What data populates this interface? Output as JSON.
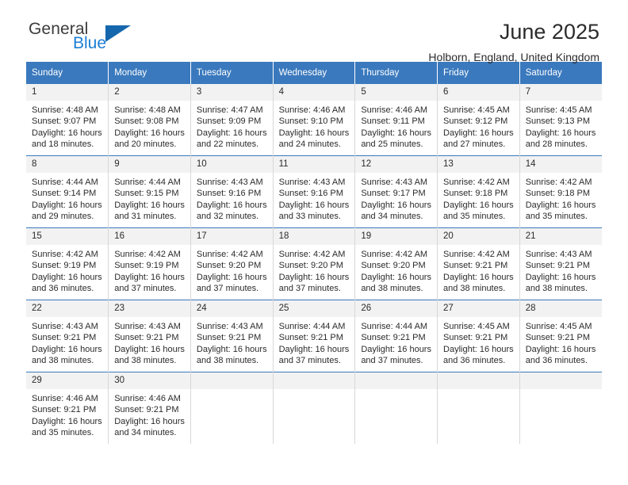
{
  "logo": {
    "primary_text": "General",
    "secondary_text": "Blue",
    "primary_color": "#3c3c3c",
    "secondary_color": "#1c7fd4",
    "triangle_color": "#1567ad"
  },
  "header": {
    "title": "June 2025",
    "subtitle": "Holborn, England, United Kingdom"
  },
  "theme": {
    "header_row_bg": "#3a79bd",
    "header_row_text": "#ffffff",
    "daynum_bg": "#f2f2f2",
    "row_divider": "#3a79bd",
    "cell_divider": "#d7d7d7"
  },
  "calendar": {
    "weekday_headers": [
      "Sunday",
      "Monday",
      "Tuesday",
      "Wednesday",
      "Thursday",
      "Friday",
      "Saturday"
    ],
    "labels": {
      "sunrise": "Sunrise:",
      "sunset": "Sunset:",
      "daylight": "Daylight:"
    },
    "weeks": [
      [
        {
          "day": "1",
          "sunrise": "Sunrise: 4:48 AM",
          "sunset": "Sunset: 9:07 PM",
          "daylight_line1": "Daylight: 16 hours",
          "daylight_line2": "and 18 minutes."
        },
        {
          "day": "2",
          "sunrise": "Sunrise: 4:48 AM",
          "sunset": "Sunset: 9:08 PM",
          "daylight_line1": "Daylight: 16 hours",
          "daylight_line2": "and 20 minutes."
        },
        {
          "day": "3",
          "sunrise": "Sunrise: 4:47 AM",
          "sunset": "Sunset: 9:09 PM",
          "daylight_line1": "Daylight: 16 hours",
          "daylight_line2": "and 22 minutes."
        },
        {
          "day": "4",
          "sunrise": "Sunrise: 4:46 AM",
          "sunset": "Sunset: 9:10 PM",
          "daylight_line1": "Daylight: 16 hours",
          "daylight_line2": "and 24 minutes."
        },
        {
          "day": "5",
          "sunrise": "Sunrise: 4:46 AM",
          "sunset": "Sunset: 9:11 PM",
          "daylight_line1": "Daylight: 16 hours",
          "daylight_line2": "and 25 minutes."
        },
        {
          "day": "6",
          "sunrise": "Sunrise: 4:45 AM",
          "sunset": "Sunset: 9:12 PM",
          "daylight_line1": "Daylight: 16 hours",
          "daylight_line2": "and 27 minutes."
        },
        {
          "day": "7",
          "sunrise": "Sunrise: 4:45 AM",
          "sunset": "Sunset: 9:13 PM",
          "daylight_line1": "Daylight: 16 hours",
          "daylight_line2": "and 28 minutes."
        }
      ],
      [
        {
          "day": "8",
          "sunrise": "Sunrise: 4:44 AM",
          "sunset": "Sunset: 9:14 PM",
          "daylight_line1": "Daylight: 16 hours",
          "daylight_line2": "and 29 minutes."
        },
        {
          "day": "9",
          "sunrise": "Sunrise: 4:44 AM",
          "sunset": "Sunset: 9:15 PM",
          "daylight_line1": "Daylight: 16 hours",
          "daylight_line2": "and 31 minutes."
        },
        {
          "day": "10",
          "sunrise": "Sunrise: 4:43 AM",
          "sunset": "Sunset: 9:16 PM",
          "daylight_line1": "Daylight: 16 hours",
          "daylight_line2": "and 32 minutes."
        },
        {
          "day": "11",
          "sunrise": "Sunrise: 4:43 AM",
          "sunset": "Sunset: 9:16 PM",
          "daylight_line1": "Daylight: 16 hours",
          "daylight_line2": "and 33 minutes."
        },
        {
          "day": "12",
          "sunrise": "Sunrise: 4:43 AM",
          "sunset": "Sunset: 9:17 PM",
          "daylight_line1": "Daylight: 16 hours",
          "daylight_line2": "and 34 minutes."
        },
        {
          "day": "13",
          "sunrise": "Sunrise: 4:42 AM",
          "sunset": "Sunset: 9:18 PM",
          "daylight_line1": "Daylight: 16 hours",
          "daylight_line2": "and 35 minutes."
        },
        {
          "day": "14",
          "sunrise": "Sunrise: 4:42 AM",
          "sunset": "Sunset: 9:18 PM",
          "daylight_line1": "Daylight: 16 hours",
          "daylight_line2": "and 35 minutes."
        }
      ],
      [
        {
          "day": "15",
          "sunrise": "Sunrise: 4:42 AM",
          "sunset": "Sunset: 9:19 PM",
          "daylight_line1": "Daylight: 16 hours",
          "daylight_line2": "and 36 minutes."
        },
        {
          "day": "16",
          "sunrise": "Sunrise: 4:42 AM",
          "sunset": "Sunset: 9:19 PM",
          "daylight_line1": "Daylight: 16 hours",
          "daylight_line2": "and 37 minutes."
        },
        {
          "day": "17",
          "sunrise": "Sunrise: 4:42 AM",
          "sunset": "Sunset: 9:20 PM",
          "daylight_line1": "Daylight: 16 hours",
          "daylight_line2": "and 37 minutes."
        },
        {
          "day": "18",
          "sunrise": "Sunrise: 4:42 AM",
          "sunset": "Sunset: 9:20 PM",
          "daylight_line1": "Daylight: 16 hours",
          "daylight_line2": "and 37 minutes."
        },
        {
          "day": "19",
          "sunrise": "Sunrise: 4:42 AM",
          "sunset": "Sunset: 9:20 PM",
          "daylight_line1": "Daylight: 16 hours",
          "daylight_line2": "and 38 minutes."
        },
        {
          "day": "20",
          "sunrise": "Sunrise: 4:42 AM",
          "sunset": "Sunset: 9:21 PM",
          "daylight_line1": "Daylight: 16 hours",
          "daylight_line2": "and 38 minutes."
        },
        {
          "day": "21",
          "sunrise": "Sunrise: 4:43 AM",
          "sunset": "Sunset: 9:21 PM",
          "daylight_line1": "Daylight: 16 hours",
          "daylight_line2": "and 38 minutes."
        }
      ],
      [
        {
          "day": "22",
          "sunrise": "Sunrise: 4:43 AM",
          "sunset": "Sunset: 9:21 PM",
          "daylight_line1": "Daylight: 16 hours",
          "daylight_line2": "and 38 minutes."
        },
        {
          "day": "23",
          "sunrise": "Sunrise: 4:43 AM",
          "sunset": "Sunset: 9:21 PM",
          "daylight_line1": "Daylight: 16 hours",
          "daylight_line2": "and 38 minutes."
        },
        {
          "day": "24",
          "sunrise": "Sunrise: 4:43 AM",
          "sunset": "Sunset: 9:21 PM",
          "daylight_line1": "Daylight: 16 hours",
          "daylight_line2": "and 38 minutes."
        },
        {
          "day": "25",
          "sunrise": "Sunrise: 4:44 AM",
          "sunset": "Sunset: 9:21 PM",
          "daylight_line1": "Daylight: 16 hours",
          "daylight_line2": "and 37 minutes."
        },
        {
          "day": "26",
          "sunrise": "Sunrise: 4:44 AM",
          "sunset": "Sunset: 9:21 PM",
          "daylight_line1": "Daylight: 16 hours",
          "daylight_line2": "and 37 minutes."
        },
        {
          "day": "27",
          "sunrise": "Sunrise: 4:45 AM",
          "sunset": "Sunset: 9:21 PM",
          "daylight_line1": "Daylight: 16 hours",
          "daylight_line2": "and 36 minutes."
        },
        {
          "day": "28",
          "sunrise": "Sunrise: 4:45 AM",
          "sunset": "Sunset: 9:21 PM",
          "daylight_line1": "Daylight: 16 hours",
          "daylight_line2": "and 36 minutes."
        }
      ],
      [
        {
          "day": "29",
          "sunrise": "Sunrise: 4:46 AM",
          "sunset": "Sunset: 9:21 PM",
          "daylight_line1": "Daylight: 16 hours",
          "daylight_line2": "and 35 minutes."
        },
        {
          "day": "30",
          "sunrise": "Sunrise: 4:46 AM",
          "sunset": "Sunset: 9:21 PM",
          "daylight_line1": "Daylight: 16 hours",
          "daylight_line2": "and 34 minutes."
        },
        {
          "day": "",
          "sunrise": "",
          "sunset": "",
          "daylight_line1": "",
          "daylight_line2": ""
        },
        {
          "day": "",
          "sunrise": "",
          "sunset": "",
          "daylight_line1": "",
          "daylight_line2": ""
        },
        {
          "day": "",
          "sunrise": "",
          "sunset": "",
          "daylight_line1": "",
          "daylight_line2": ""
        },
        {
          "day": "",
          "sunrise": "",
          "sunset": "",
          "daylight_line1": "",
          "daylight_line2": ""
        },
        {
          "day": "",
          "sunrise": "",
          "sunset": "",
          "daylight_line1": "",
          "daylight_line2": ""
        }
      ]
    ]
  }
}
